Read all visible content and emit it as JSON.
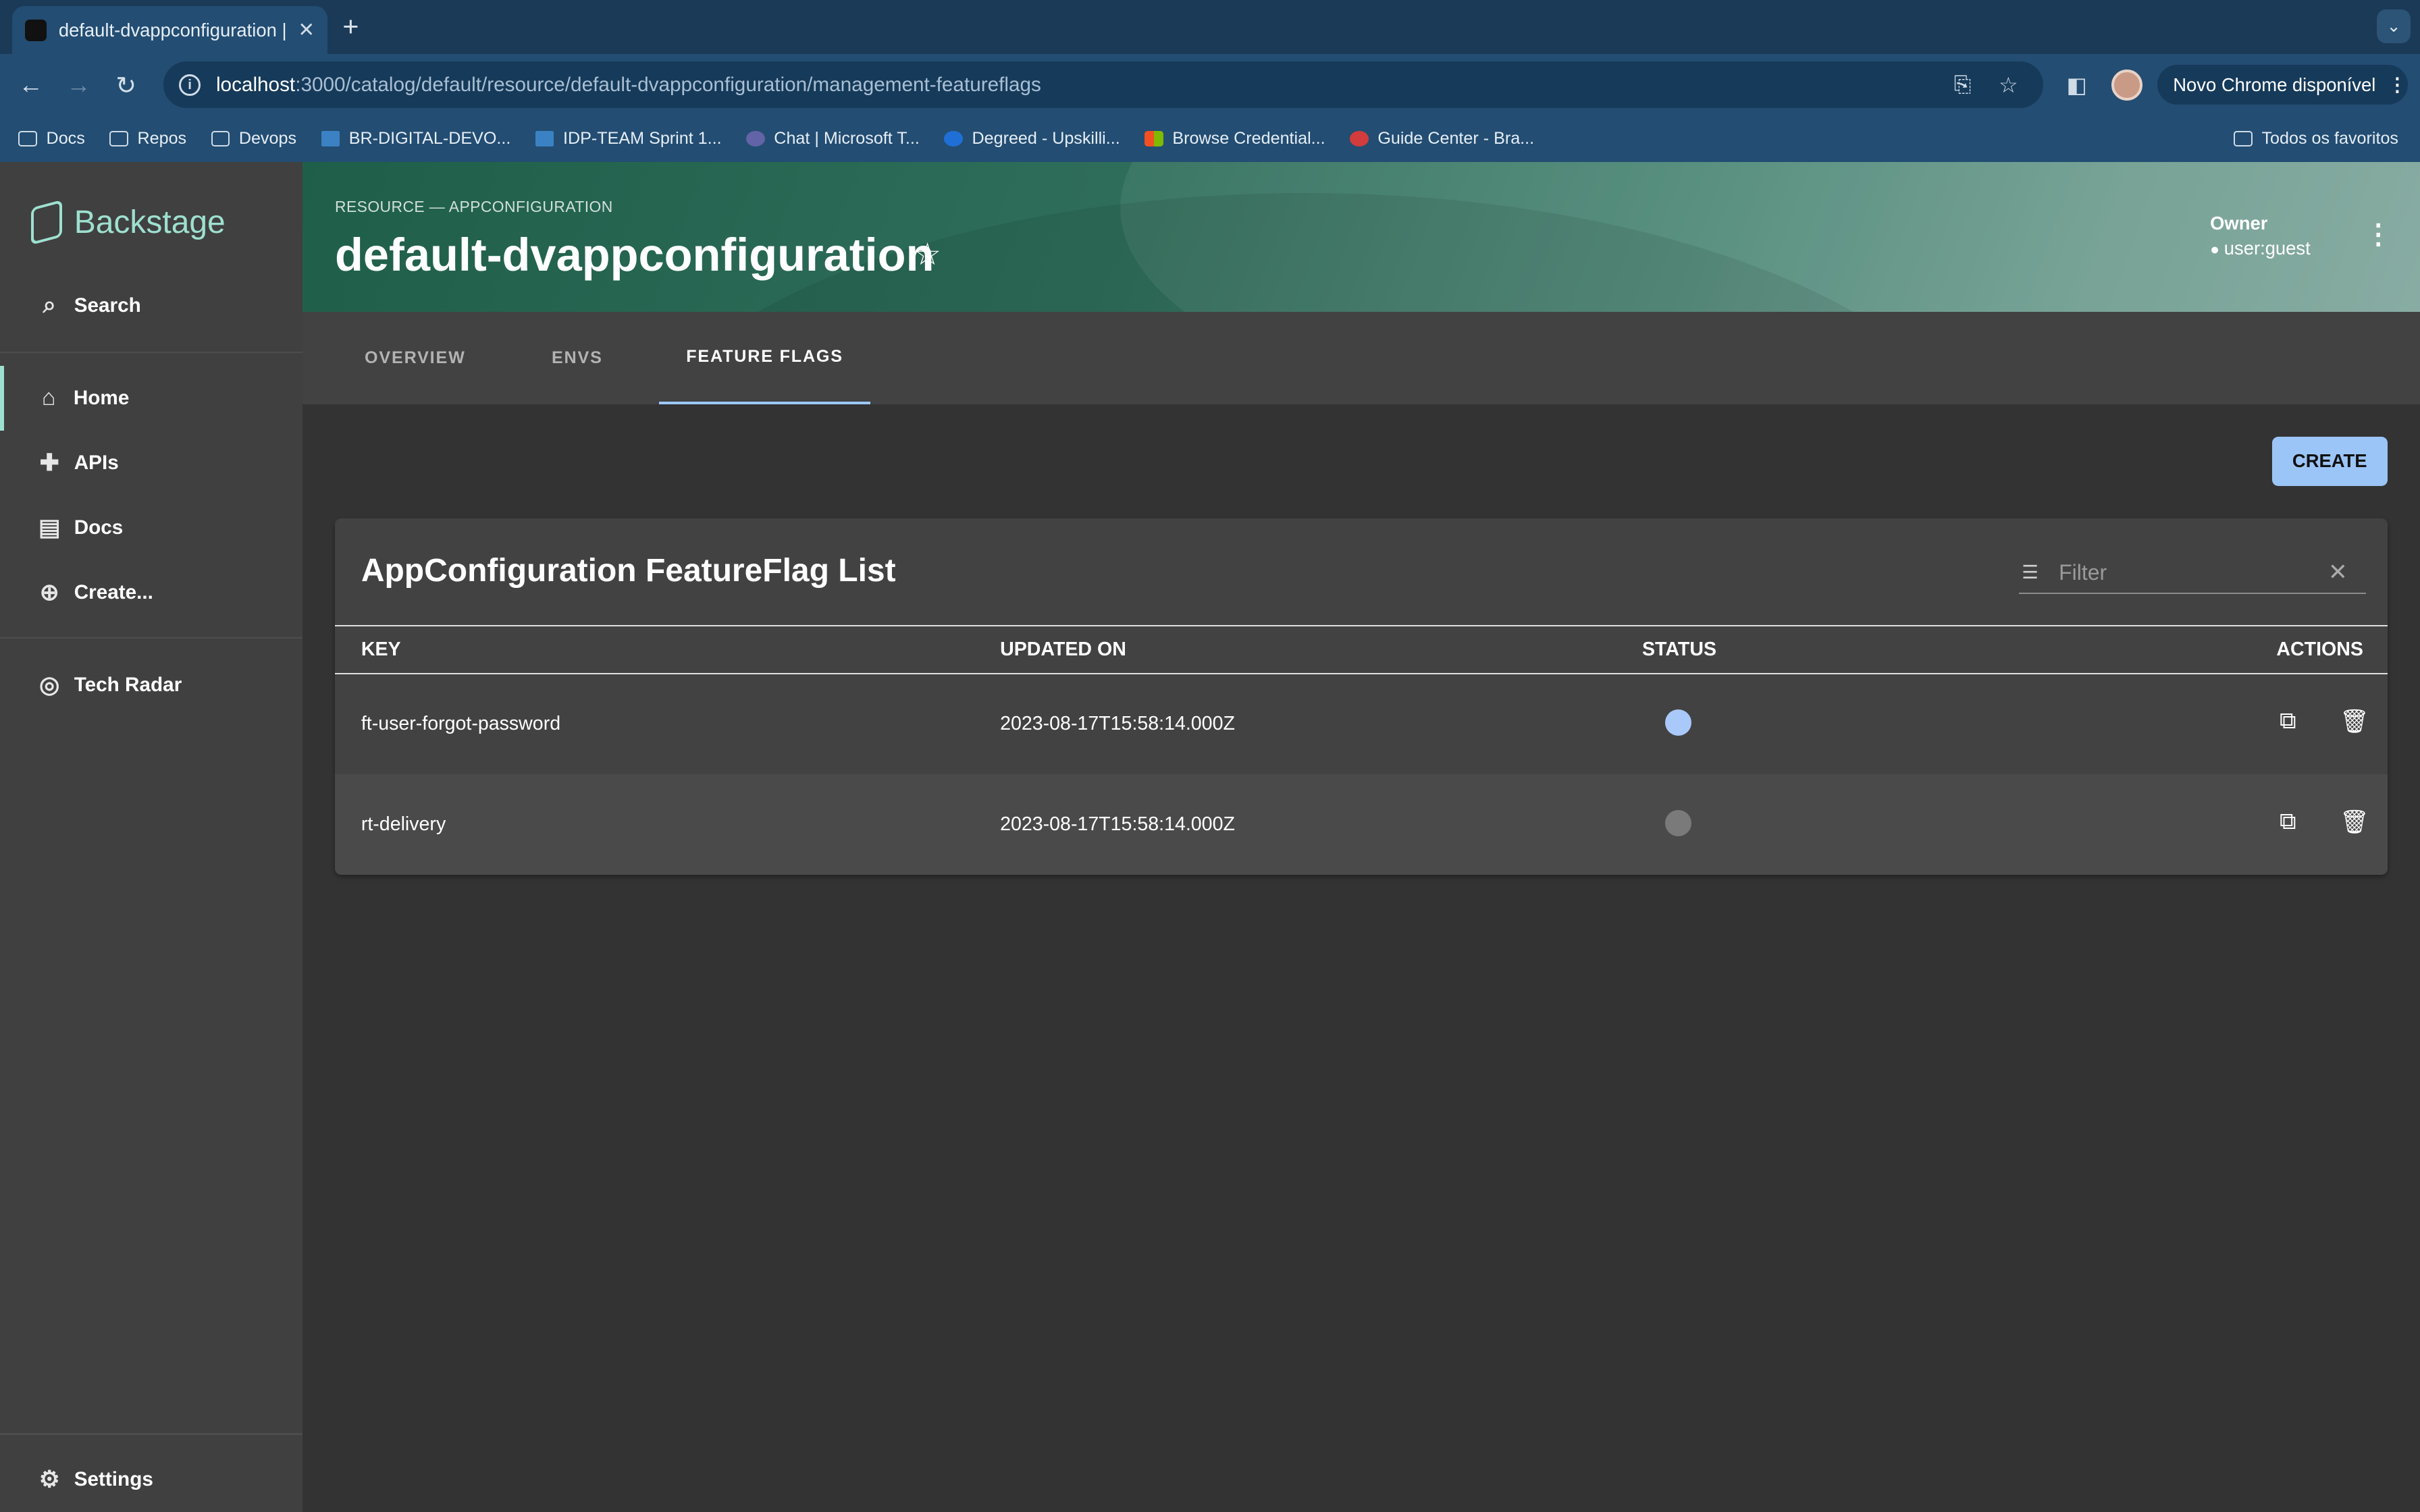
{
  "browser": {
    "tab_title": "default-dvappconfiguration | B",
    "url_host": "localhost",
    "url_path": ":3000/catalog/default/resource/default-dvappconfiguration/management-featureflags",
    "chrome_update": "Novo Chrome disponível",
    "bookmarks": [
      {
        "label": "Docs",
        "icon": "folder-icon"
      },
      {
        "label": "Repos",
        "icon": "folder-icon"
      },
      {
        "label": "Devops",
        "icon": "folder-icon"
      },
      {
        "label": "BR-DIGITAL-DEVO...",
        "icon": "azure-devops-icon"
      },
      {
        "label": "IDP-TEAM Sprint 1...",
        "icon": "azure-devops-icon"
      },
      {
        "label": "Chat | Microsoft T...",
        "icon": "teams-icon"
      },
      {
        "label": "Degreed - Upskilli...",
        "icon": "degreed-icon"
      },
      {
        "label": "Browse Credential...",
        "icon": "microsoft-icon"
      },
      {
        "label": "Guide Center - Bra...",
        "icon": "guide-icon"
      }
    ],
    "all_bookmarks": "Todos os favoritos"
  },
  "sidebar": {
    "brand": "Backstage",
    "search": "Search",
    "items": [
      {
        "label": "Home",
        "icon": "home-icon"
      },
      {
        "label": "APIs",
        "icon": "puzzle-icon"
      },
      {
        "label": "Docs",
        "icon": "library-icon"
      },
      {
        "label": "Create...",
        "icon": "add-circle-icon"
      }
    ],
    "tech_radar": "Tech Radar",
    "settings": "Settings"
  },
  "header": {
    "breadcrumb": "RESOURCE — APPCONFIGURATION",
    "title": "default-dvappconfiguration",
    "owner_label": "Owner",
    "owner_value": "user:guest"
  },
  "tabs": [
    "OVERVIEW",
    "ENVS",
    "FEATURE FLAGS"
  ],
  "selected_tab": "FEATURE FLAGS",
  "create_button": "CREATE",
  "table": {
    "title": "AppConfiguration FeatureFlag List",
    "filter_placeholder": "Filter",
    "columns": [
      "KEY",
      "UPDATED ON",
      "STATUS",
      "ACTIONS"
    ],
    "rows": [
      {
        "key": "ft-user-forgot-password",
        "updated_on": "2023-08-17T15:58:14.000Z",
        "status_enabled": true
      },
      {
        "key": "rt-delivery",
        "updated_on": "2023-08-17T15:58:14.000Z",
        "status_enabled": false
      }
    ]
  },
  "colors": {
    "accent": "#9ee0d0",
    "primary_button": "#9cc5f7",
    "status_on": "#a9c9fb",
    "status_off": "#7a7a7a"
  }
}
